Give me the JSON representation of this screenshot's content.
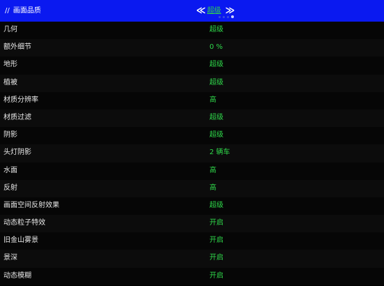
{
  "header": {
    "slashes": "//",
    "title": "画面品质",
    "selected_value": "超级",
    "prev_arrow": "≪",
    "next_arrow": "≫"
  },
  "settings": [
    {
      "label": "几何",
      "value": "超级"
    },
    {
      "label": "额外细节",
      "value": "0 %"
    },
    {
      "label": "地形",
      "value": "超级"
    },
    {
      "label": "植被",
      "value": "超级"
    },
    {
      "label": "材质分辨率",
      "value": "高"
    },
    {
      "label": "材质过滤",
      "value": "超级"
    },
    {
      "label": "阴影",
      "value": "超级"
    },
    {
      "label": "头灯阴影",
      "value": "2 辆车"
    },
    {
      "label": "水面",
      "value": "高"
    },
    {
      "label": "反射",
      "value": "高"
    },
    {
      "label": "画面空间反射效果",
      "value": "超级"
    },
    {
      "label": "动态粒子特效",
      "value": "开启"
    },
    {
      "label": "旧金山雾景",
      "value": "开启"
    },
    {
      "label": "景深",
      "value": "开启"
    },
    {
      "label": "动态模糊",
      "value": "开启"
    }
  ],
  "colors": {
    "header_bg": "#0a19f0",
    "value_green": "#2fd84a",
    "label_white": "#e8e8e8"
  }
}
